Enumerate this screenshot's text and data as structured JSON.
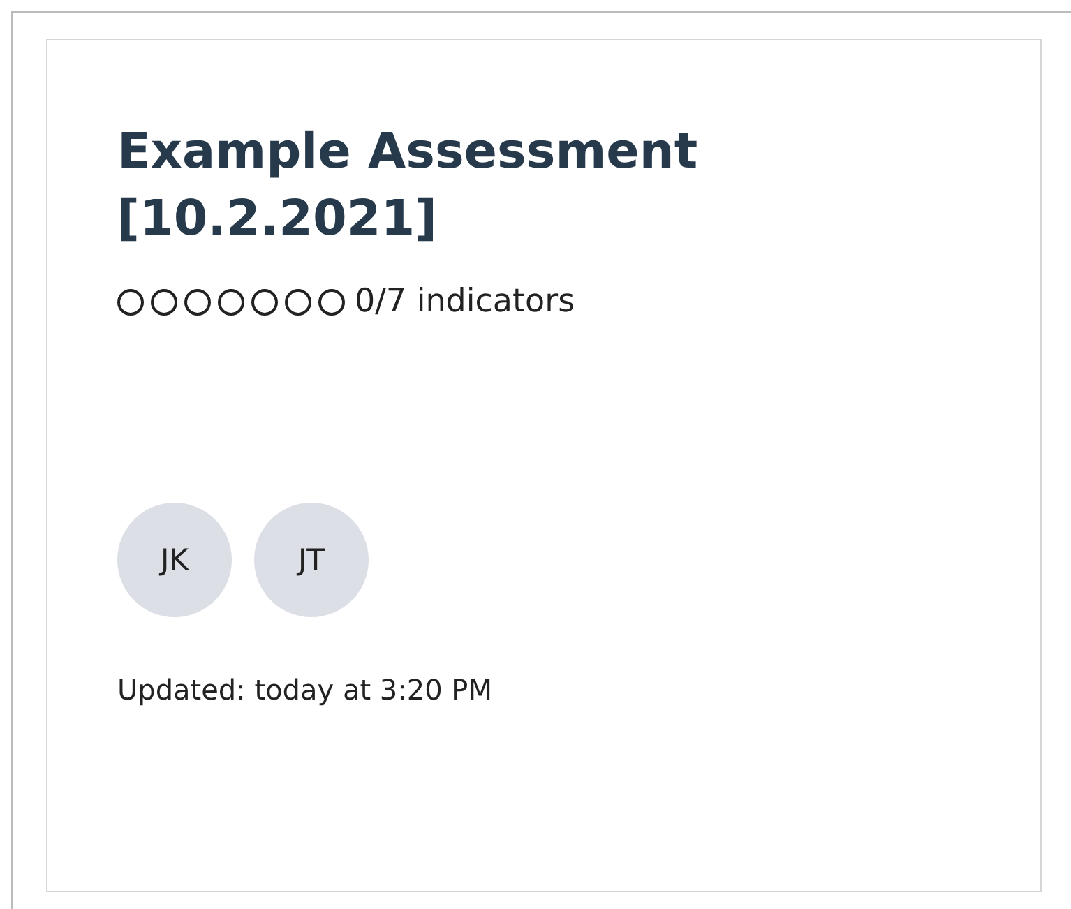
{
  "card": {
    "title": "Example Assessment [10.2.2021]",
    "indicators": [
      {
        "done": false
      },
      {
        "done": false
      },
      {
        "done": false
      },
      {
        "done": false
      },
      {
        "done": false
      },
      {
        "done": false
      },
      {
        "done": false
      }
    ],
    "indicator_count": "0/7 indicators",
    "avatars": [
      "JK",
      "JT"
    ],
    "updated": "Updated: today at 3:20 PM"
  }
}
